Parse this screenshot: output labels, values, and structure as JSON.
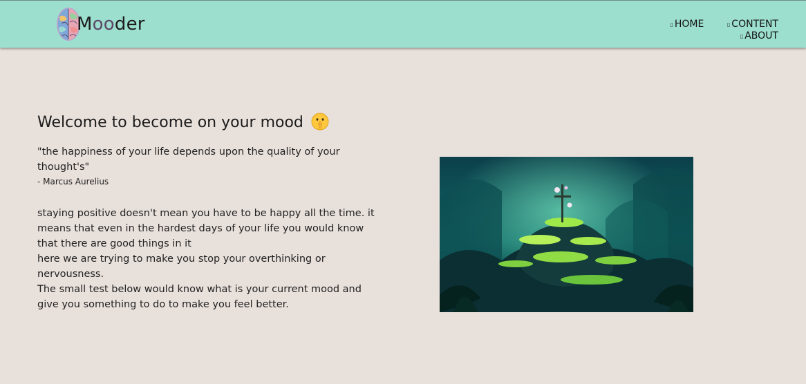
{
  "header": {
    "brand_first": "M",
    "brand_middle": "oo",
    "brand_last": "der",
    "nav": [
      {
        "label": "HOME"
      },
      {
        "label": "CONTENT"
      },
      {
        "label": "ABOUT"
      }
    ]
  },
  "main": {
    "title": "Welcome to become on your mood",
    "quote": "\"the happiness of your life depends upon the quality of your thought's\"",
    "author": "- Marcus Aurelius",
    "paragraph_lines": [
      "staying positive doesn't mean you have to be happy all the time. it means that even in the hardest days of your life you would know that there are good things in it",
      "here we are trying to make you stop your overthinking or nervousness.",
      "The small test below would know what is your current mood and give you something to do to make you feel better."
    ]
  },
  "colors": {
    "navbar": "#9ddfcf",
    "background": "#e8e0db",
    "brand_accent": "#5b4866"
  }
}
